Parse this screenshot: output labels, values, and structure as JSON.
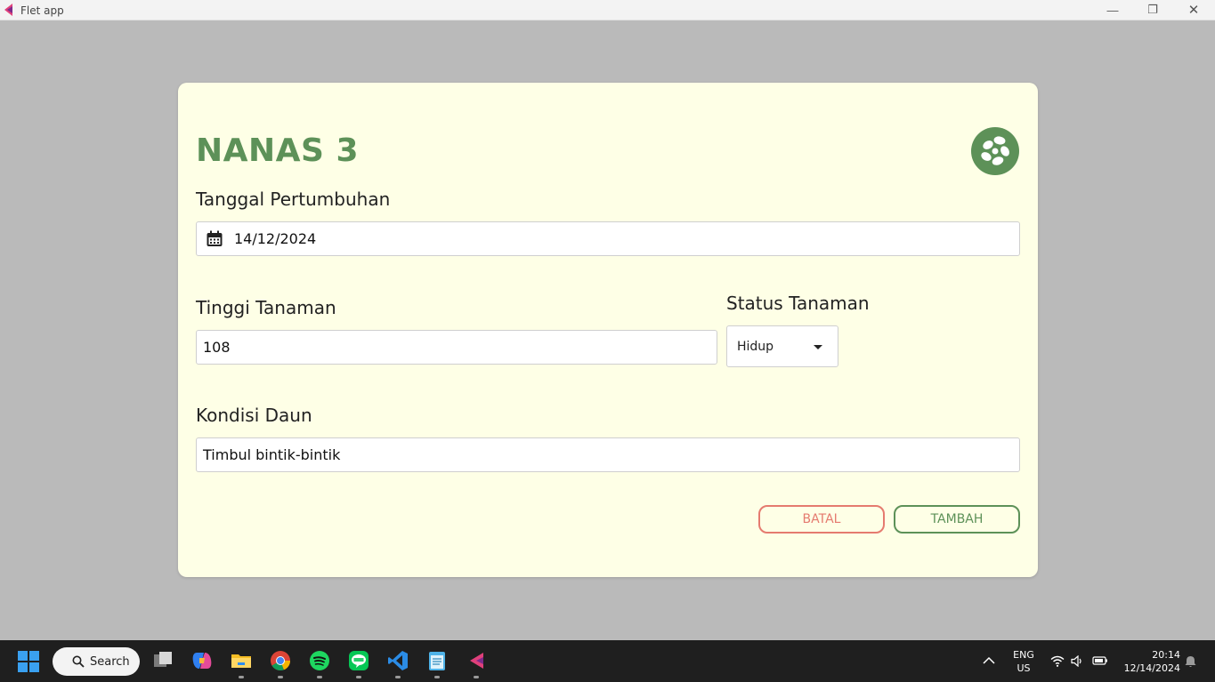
{
  "window": {
    "title": "Flet app",
    "minimize_glyph": "—",
    "restore_glyph": "❐",
    "close_glyph": "✕"
  },
  "form": {
    "title": "NANAS 3",
    "logo_icon": "flower-icon",
    "date_label": "Tanggal Pertumbuhan",
    "date_value": "14/12/2024",
    "height_label": "Tinggi Tanaman",
    "height_value": "108",
    "status_label": "Status Tanaman",
    "status_value": "Hidup",
    "leaf_label": "Kondisi Daun",
    "leaf_value": "Timbul bintik-bintik",
    "cancel_label": "BATAL",
    "add_label": "TAMBAH"
  },
  "colors": {
    "accent_green": "#5d9158",
    "cancel_red": "#e57b6f",
    "card_bg": "#feffe6",
    "backdrop": "#bababa"
  },
  "taskbar": {
    "search_label": "Search",
    "apps": [
      "windows-start-icon",
      "task-view-icon",
      "copilot-icon",
      "file-explorer-icon",
      "chrome-icon",
      "spotify-icon",
      "line-icon",
      "vscode-icon",
      "notepad-icon",
      "flet-icon"
    ],
    "lang_top": "ENG",
    "lang_bottom": "US",
    "time": "20:14",
    "date": "12/14/2024"
  }
}
